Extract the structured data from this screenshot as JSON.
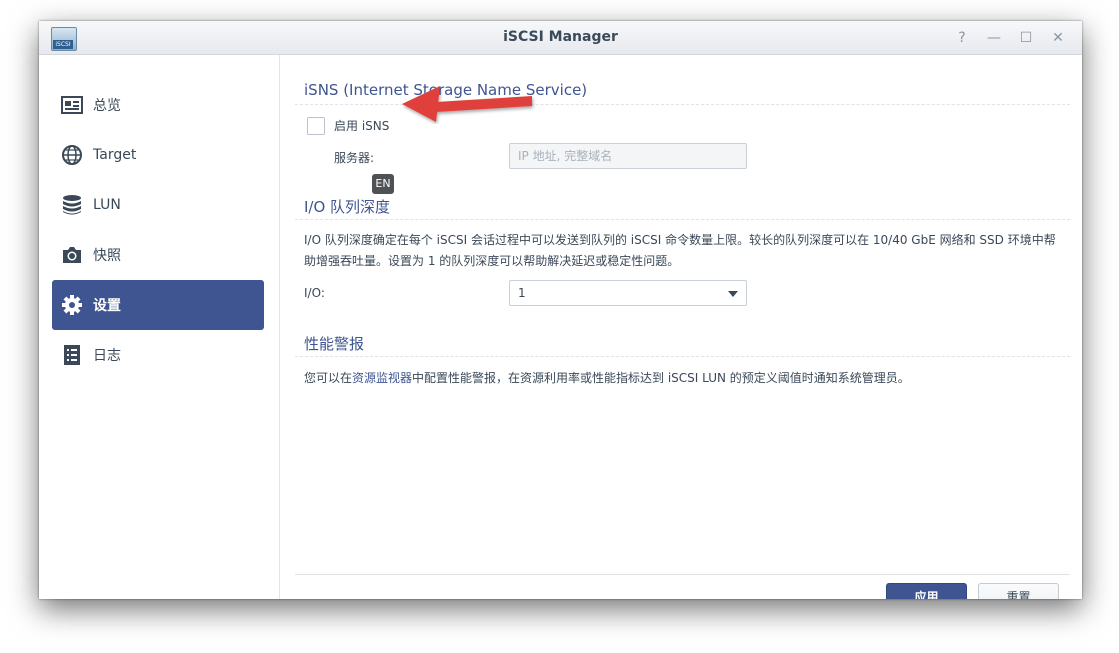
{
  "window": {
    "title": "iSCSI Manager",
    "app_icon_label": "iSCSI",
    "controls": {
      "help": "?",
      "minimize": "—",
      "maximize": "☐",
      "close": "✕"
    }
  },
  "sidebar": {
    "items": [
      {
        "label": "总览",
        "icon": "overview-icon"
      },
      {
        "label": "Target",
        "icon": "globe-icon"
      },
      {
        "label": "LUN",
        "icon": "database-icon"
      },
      {
        "label": "快照",
        "icon": "camera-icon"
      },
      {
        "label": "设置",
        "icon": "gear-icon",
        "active": true
      },
      {
        "label": "日志",
        "icon": "log-icon"
      }
    ]
  },
  "isns": {
    "title": "iSNS (Internet Storage Name Service)",
    "enable_label": "启用 iSNS",
    "enabled": false,
    "server_label": "服务器:",
    "server_placeholder": "IP 地址, 完整域名"
  },
  "io": {
    "title": "I/O 队列深度",
    "description": "I/O 队列深度确定在每个 iSCSI 会话过程中可以发送到队列的 iSCSI 命令数量上限。较长的队列深度可以在 10/40 GbE 网络和 SSD 环境中帮助增强吞吐量。设置为 1 的队列深度可以帮助解决延迟或稳定性问题。",
    "label": "I/O:",
    "value": "1"
  },
  "perf": {
    "title": "性能警报",
    "desc_before": "您可以在",
    "desc_link": "资源监视器",
    "desc_after": "中配置性能警报，在资源利用率或性能指标达到 iSCSI LUN 的预定义阈值时通知系统管理员。"
  },
  "tooltip": {
    "ime": "EN"
  },
  "footer": {
    "apply": "应用",
    "reset": "重置"
  },
  "colors": {
    "accent": "#3f5591",
    "arrow": "#e0403a"
  }
}
